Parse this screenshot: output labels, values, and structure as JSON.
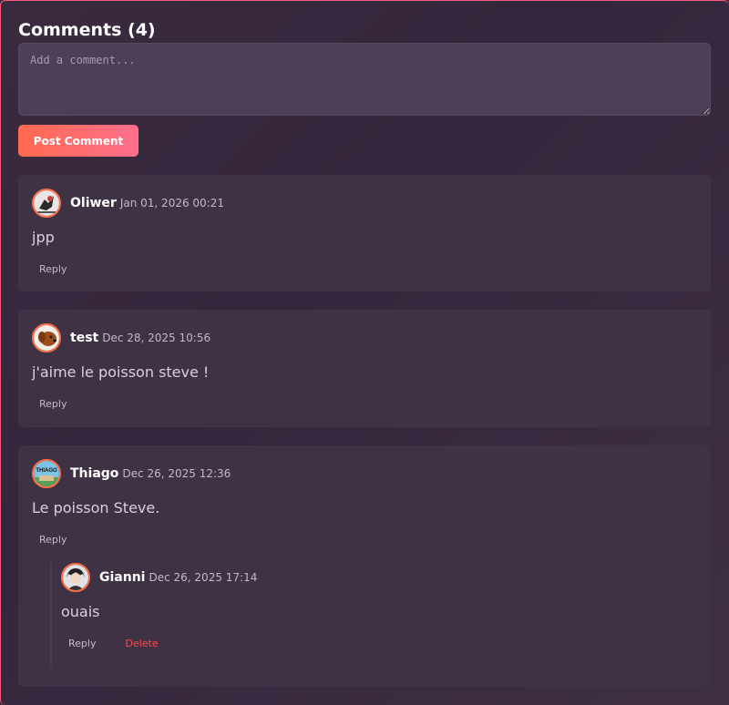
{
  "comments_section": {
    "title": "Comments (4)",
    "input_placeholder": "Add a comment...",
    "post_label": "Post Comment"
  },
  "comments": [
    {
      "author": "Oliwer",
      "date": "Jan 01, 2026 00:21",
      "text": "jpp",
      "reply_label": "Reply",
      "avatar": "oliwer-avatar"
    },
    {
      "author": "test",
      "date": "Dec 28, 2025 10:56",
      "text": "j'aime le poisson steve !",
      "reply_label": "Reply",
      "avatar": "dog-avatar"
    },
    {
      "author": "Thiago",
      "date": "Dec 26, 2025 12:36",
      "text": "Le poisson Steve.",
      "reply_label": "Reply",
      "avatar": "thiago-avatar",
      "replies": [
        {
          "author": "Gianni",
          "date": "Dec 26, 2025 17:14",
          "text": "ouais",
          "reply_label": "Reply",
          "delete_label": "Delete",
          "avatar": "gianni-avatar"
        }
      ]
    }
  ],
  "thiago_avatar_text": "THIAGO",
  "colors": {
    "accent": "#ff6a4f",
    "accent_end": "#ff6f8d",
    "delete": "#ff4b4b",
    "card": "#403245"
  }
}
